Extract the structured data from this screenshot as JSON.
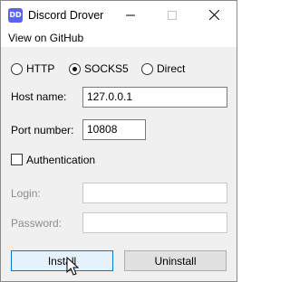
{
  "window": {
    "title": "Discord Drover",
    "app_icon_text": "DD"
  },
  "menu": {
    "items": [
      "View on GitHub"
    ]
  },
  "proxy": {
    "options": [
      "HTTP",
      "SOCKS5",
      "Direct"
    ],
    "selected": "SOCKS5"
  },
  "host": {
    "label": "Host name:",
    "value": "127.0.0.1"
  },
  "port": {
    "label": "Port number:",
    "value": "10808"
  },
  "auth": {
    "label": "Authentication",
    "checked": false
  },
  "login": {
    "label": "Login:",
    "value": ""
  },
  "password": {
    "label": "Password:",
    "value": ""
  },
  "buttons": {
    "install": "Install",
    "uninstall": "Uninstall"
  }
}
